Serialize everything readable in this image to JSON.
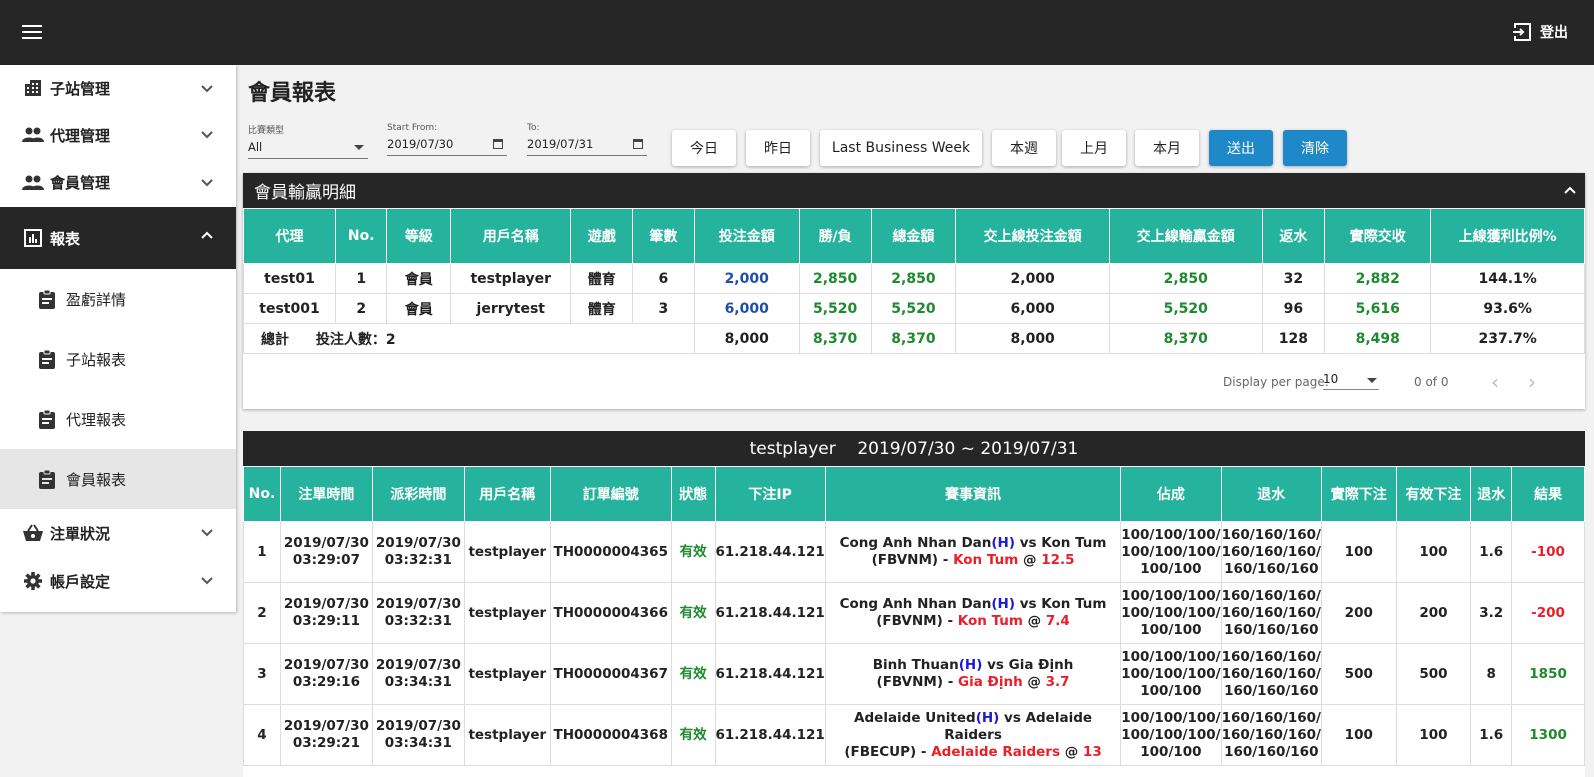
{
  "topbar": {
    "logout_label": "登出"
  },
  "sidebar": {
    "items": [
      {
        "label": "子站管理",
        "icon": "building-icon"
      },
      {
        "label": "代理管理",
        "icon": "people-icon"
      },
      {
        "label": "會員管理",
        "icon": "people-icon"
      },
      {
        "label": "報表",
        "icon": "chart-icon",
        "active": true
      },
      {
        "label": "盈虧詳情",
        "icon": "clipboard-icon"
      },
      {
        "label": "子站報表",
        "icon": "clipboard-icon"
      },
      {
        "label": "代理報表",
        "icon": "clipboard-icon"
      },
      {
        "label": "會員報表",
        "icon": "clipboard-icon",
        "selected": true
      },
      {
        "label": "注單狀況",
        "icon": "basket-icon"
      },
      {
        "label": "帳戶設定",
        "icon": "gear-icon"
      }
    ]
  },
  "page": {
    "title": "會員報表"
  },
  "filters": {
    "game_type": {
      "label": "比賽類型",
      "value": "All"
    },
    "start": {
      "label": "Start From:",
      "value": "2019/07/30"
    },
    "end": {
      "label": "To:",
      "value": "2019/07/31"
    }
  },
  "buttons": {
    "today": "今日",
    "yesterday": "昨日",
    "last_business_week": "Last Business Week",
    "this_week": "本週",
    "last_month": "上月",
    "this_month": "本月",
    "submit": "送出",
    "clear": "清除"
  },
  "summary": {
    "title": "會員輸贏明細",
    "headers": [
      "代理",
      "No.",
      "等級",
      "用戶名稱",
      "遊戲",
      "筆數",
      "投注金額",
      "勝/負",
      "總金額",
      "交上線投注金額",
      "交上線輸贏金額",
      "返水",
      "實際交收",
      "上線獲利比例%"
    ],
    "rows": [
      [
        "test01",
        "1",
        "會員",
        "testplayer",
        "體育",
        "6",
        "2,000",
        "2,850",
        "2,850",
        "2,000",
        "2,850",
        "32",
        "2,882",
        "144.1%"
      ],
      [
        "test001",
        "2",
        "會員",
        "jerrytest",
        "體育",
        "3",
        "6,000",
        "5,520",
        "5,520",
        "6,000",
        "5,520",
        "96",
        "5,616",
        "93.6%"
      ]
    ],
    "total": {
      "label": "總計",
      "bettors": "投注人數：2",
      "values": [
        "8,000",
        "8,370",
        "8,370",
        "8,000",
        "8,370",
        "128",
        "8,498",
        "237.7%"
      ]
    },
    "pager": {
      "label": "Display per page:",
      "per_page": "10",
      "count": "0 of 0"
    }
  },
  "detail": {
    "title": "testplayer    2019/07/30 ~ 2019/07/31",
    "headers": [
      "No.",
      "注單時間",
      "派彩時間",
      "用戶名稱",
      "訂單編號",
      "狀態",
      "下注IP",
      "賽事資訊",
      "佔成",
      "退水",
      "實際下注",
      "有效下注",
      "退水",
      "結果"
    ],
    "rows": [
      {
        "no": "1",
        "bet_date": "2019/07/30",
        "bet_time": "03:29:07",
        "pay_date": "2019/07/30",
        "pay_time": "03:32:31",
        "user": "testplayer",
        "order": "TH0000004365",
        "status": "有效",
        "ip": "61.218.44.121",
        "home": "Cong Anh Nhan Dan",
        "h": "(H)",
        "vs": " vs Kon Tum",
        "league": "(FBVNM) - ",
        "pick": "Kon Tum",
        "at": " @ ",
        "odds": "12.5",
        "share1": "100/100/100/",
        "share2": "100/100/100/",
        "share3": "100/100",
        "rebate1": "160/160/160/",
        "rebate2": "160/160/160/",
        "rebate3": "160/160/160",
        "actual": "100",
        "valid": "100",
        "rw": "1.6",
        "result": "-100"
      },
      {
        "no": "2",
        "bet_date": "2019/07/30",
        "bet_time": "03:29:11",
        "pay_date": "2019/07/30",
        "pay_time": "03:32:31",
        "user": "testplayer",
        "order": "TH0000004366",
        "status": "有效",
        "ip": "61.218.44.121",
        "home": "Cong Anh Nhan Dan",
        "h": "(H)",
        "vs": " vs Kon Tum",
        "league": "(FBVNM) - ",
        "pick": "Kon Tum",
        "at": " @ ",
        "odds": "7.4",
        "share1": "100/100/100/",
        "share2": "100/100/100/",
        "share3": "100/100",
        "rebate1": "160/160/160/",
        "rebate2": "160/160/160/",
        "rebate3": "160/160/160",
        "actual": "200",
        "valid": "200",
        "rw": "3.2",
        "result": "-200"
      },
      {
        "no": "3",
        "bet_date": "2019/07/30",
        "bet_time": "03:29:16",
        "pay_date": "2019/07/30",
        "pay_time": "03:34:31",
        "user": "testplayer",
        "order": "TH0000004367",
        "status": "有效",
        "ip": "61.218.44.121",
        "home": "Binh Thuan",
        "h": "(H)",
        "vs": " vs Gia Định",
        "league": "(FBVNM) - ",
        "pick": "Gia Định",
        "at": " @ ",
        "odds": "3.7",
        "share1": "100/100/100/",
        "share2": "100/100/100/",
        "share3": "100/100",
        "rebate1": "160/160/160/",
        "rebate2": "160/160/160/",
        "rebate3": "160/160/160",
        "actual": "500",
        "valid": "500",
        "rw": "8",
        "result": "1850"
      },
      {
        "no": "4",
        "bet_date": "2019/07/30",
        "bet_time": "03:29:21",
        "pay_date": "2019/07/30",
        "pay_time": "03:34:31",
        "user": "testplayer",
        "order": "TH0000004368",
        "status": "有效",
        "ip": "61.218.44.121",
        "home": "Adelaide United",
        "h": "(H)",
        "vs": " vs Adelaide Raiders",
        "league": "(FBECUP) - ",
        "pick": "Adelaide Raiders",
        "at": " @ ",
        "odds": "13",
        "share1": "100/100/100/",
        "share2": "100/100/100/",
        "share3": "100/100",
        "rebate1": "160/160/160/",
        "rebate2": "160/160/160/",
        "rebate3": "160/160/160",
        "actual": "100",
        "valid": "100",
        "rw": "1.6",
        "result": "1300"
      }
    ]
  },
  "colors": {
    "teal": "#26b39d",
    "dark": "#262626",
    "primary": "#1e88c8",
    "win": "#1e8a2e",
    "loss": "#e8202a"
  }
}
